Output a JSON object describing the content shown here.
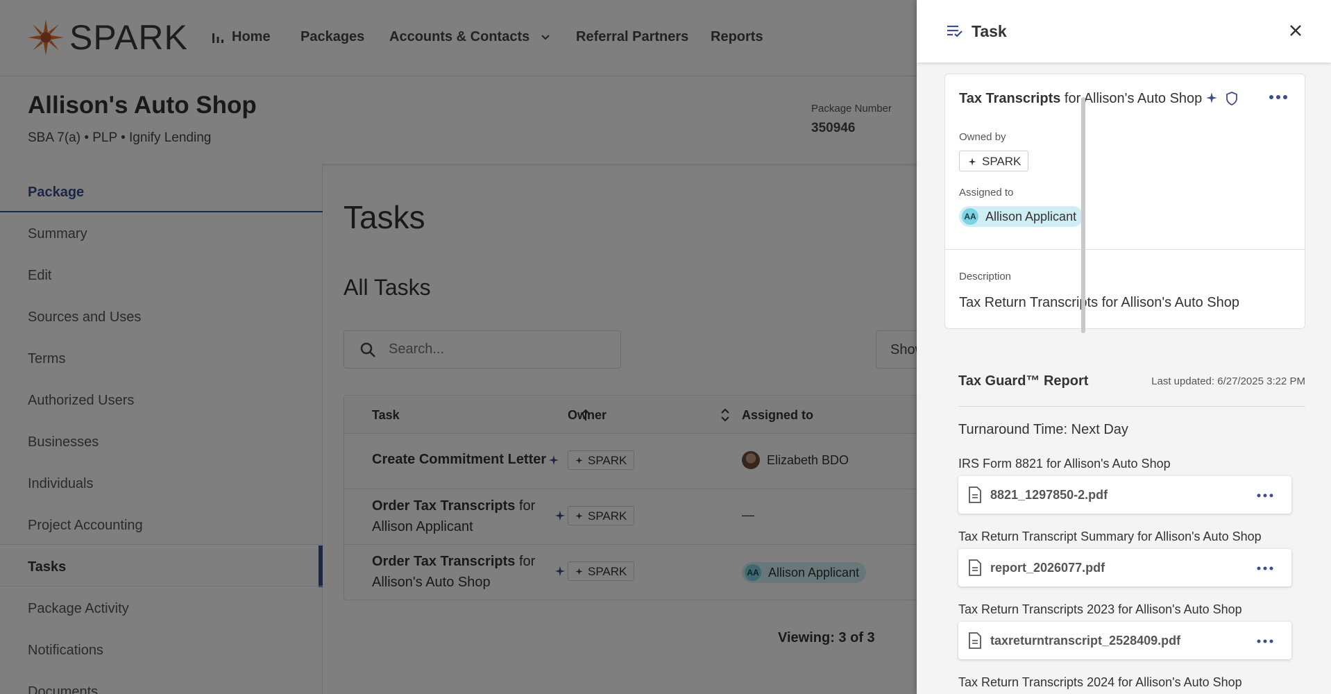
{
  "app": {
    "logo_text": "SPARK",
    "nav": [
      "Home",
      "Packages",
      "Accounts & Contacts",
      "Referral Partners",
      "Reports"
    ]
  },
  "package": {
    "title": "Allison's Auto Shop",
    "subtitle": "SBA 7(a) • PLP • Ignify Lending",
    "number_label": "Package Number",
    "number": "350946"
  },
  "sidebar": {
    "heading": "Package",
    "items": [
      "Summary",
      "Edit",
      "Sources and Uses",
      "Terms",
      "Authorized Users",
      "Businesses",
      "Individuals",
      "Project Accounting",
      "Tasks",
      "Package Activity",
      "Notifications",
      "Documents"
    ],
    "active": "Tasks"
  },
  "tasks": {
    "title": "Tasks",
    "subtitle": "All Tasks",
    "search_placeholder": "Search...",
    "show_label": "Show",
    "columns": [
      "Task",
      "Owner",
      "Assigned to"
    ],
    "rows": [
      {
        "task_bold": "Create Commitment Letter",
        "task_rest": "",
        "owner": "SPARK",
        "assigned": "Elizabeth BDO"
      },
      {
        "task_bold": "Order Tax Transcripts",
        "task_rest": " for Allison Applicant",
        "owner": "SPARK",
        "assigned": "—"
      },
      {
        "task_bold": "Order Tax Transcripts",
        "task_rest": " for Allison's Auto Shop",
        "owner": "SPARK",
        "assigned": "Allison Applicant",
        "assigned_initials": "AA"
      }
    ],
    "viewing": "Viewing: 3 of 3"
  },
  "drawer": {
    "title": "Task",
    "card": {
      "title_bold": "Tax Transcripts",
      "title_rest": " for Allison's Auto Shop",
      "owned_by_label": "Owned by",
      "owner": "SPARK",
      "assigned_to_label": "Assigned to",
      "assignee": "Allison Applicant",
      "assignee_initials": "AA",
      "description_label": "Description",
      "description": "Tax Return Transcripts for Allison's Auto Shop"
    },
    "report": {
      "title": "Tax Guard™ Report",
      "updated": "Last updated: 6/27/2025 3:22 PM",
      "turnaround": "Turnaround Time: Next Day",
      "documents": [
        {
          "label": "IRS Form 8821 for Allison's Auto Shop",
          "file": "8821_1297850-2.pdf"
        },
        {
          "label": "Tax Return Transcript Summary for Allison's Auto Shop",
          "file": "report_2026077.pdf"
        },
        {
          "label": "Tax Return Transcripts 2023 for Allison's Auto Shop",
          "file": "taxreturntranscript_2528409.pdf"
        },
        {
          "label": "Tax Return Transcripts 2024 for Allison's Auto Shop",
          "file": ""
        }
      ]
    }
  },
  "colors": {
    "brand_orange": "#e8742a",
    "primary": "#3b4d8a",
    "chip_cyan": "#cfeef4",
    "avatar_cyan": "#7ed3e3"
  }
}
